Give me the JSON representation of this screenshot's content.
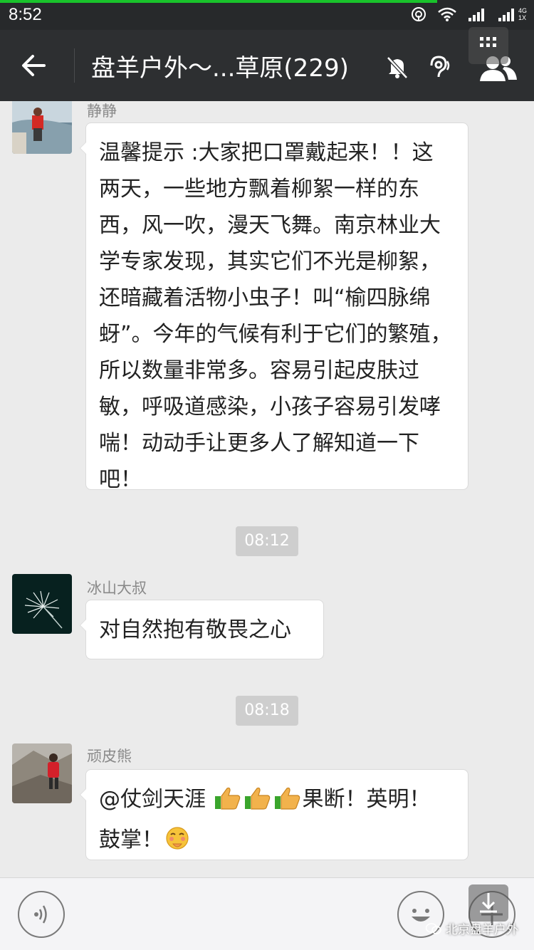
{
  "status_bar": {
    "time": "8:52",
    "network_label_top": "4G",
    "network_label_bottom": "1X"
  },
  "header": {
    "title": "盘羊户外～...草原(229)",
    "icons": [
      "back-arrow-icon",
      "mute-bell-icon",
      "earpiece-icon",
      "group-members-icon"
    ]
  },
  "messages": [
    {
      "sender": "静静",
      "text": "温馨提示 :大家把口罩戴起来！！这两天，一些地方飘着柳絮一样的东西，风一吹，漫天飞舞。南京林业大学专家发现，其实它们不光是柳絮，还暗藏着活物小虫子！叫“榆四脉绵蚜”。今年的气候有利于它们的繁殖，所以数量非常多。容易引起皮肤过敏，呼吸道感染，小孩子容易引发哮喘！动动手让更多人了解知道一下吧！"
    },
    {
      "timestamp": "08:12"
    },
    {
      "sender": "冰山大叔",
      "text": "对自然抱有敬畏之心"
    },
    {
      "timestamp": "08:18"
    },
    {
      "sender": "顽皮熊",
      "text_part1": "@仗剑天涯 ",
      "text_part2": "果断！英明！",
      "text_part3": "鼓掌！"
    }
  ],
  "input_bar": {
    "watermark": "北京盘羊户外"
  },
  "colors": {
    "status_accent": "#19c32b",
    "title_bar": "#2d2f31",
    "chat_bg": "#ebebeb",
    "timestamp_bg": "#cecece"
  }
}
